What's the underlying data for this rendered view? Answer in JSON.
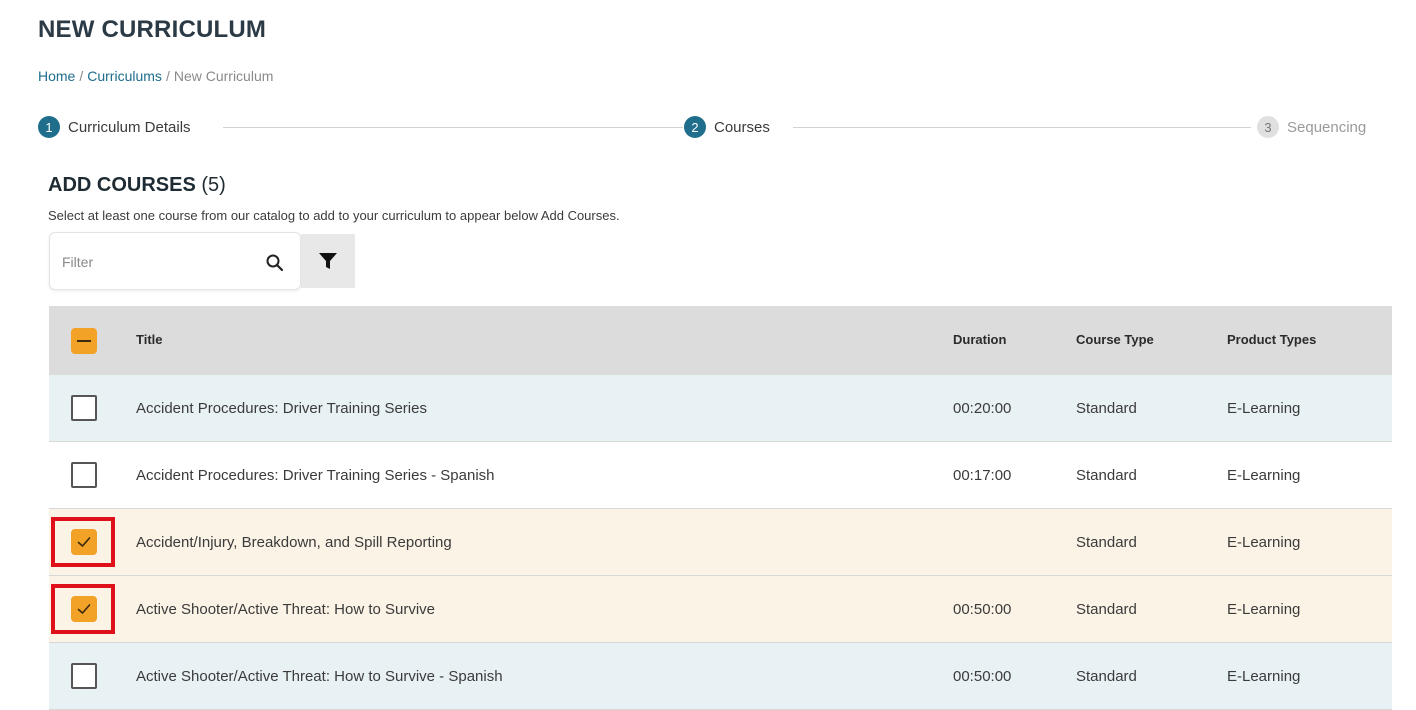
{
  "page": {
    "title": "NEW CURRICULUM"
  },
  "breadcrumb": {
    "home": "Home",
    "curriculums": "Curriculums",
    "current": "New Curriculum",
    "separator": "/"
  },
  "stepper": {
    "steps": [
      {
        "number": "1",
        "label": "Curriculum Details",
        "state": "active"
      },
      {
        "number": "2",
        "label": "Courses",
        "state": "active"
      },
      {
        "number": "3",
        "label": "Sequencing",
        "state": "inactive"
      }
    ]
  },
  "section": {
    "title": "ADD COURSES",
    "count": "(5)",
    "description": "Select at least one course from our catalog to add to your curriculum to appear below Add Courses."
  },
  "filter": {
    "placeholder": "Filter",
    "search_icon": "search-icon",
    "filter_icon": "funnel-icon"
  },
  "table": {
    "headers": {
      "title": "Title",
      "duration": "Duration",
      "course_type": "Course Type",
      "product_types": "Product Types"
    },
    "select_all_state": "partial",
    "rows": [
      {
        "title": "Accident Procedures: Driver Training Series",
        "duration": "00:20:00",
        "course_type": "Standard",
        "product_types": "E-Learning",
        "checked": false,
        "highlighted": false
      },
      {
        "title": "Accident Procedures: Driver Training Series - Spanish",
        "duration": "00:17:00",
        "course_type": "Standard",
        "product_types": "E-Learning",
        "checked": false,
        "highlighted": false
      },
      {
        "title": "Accident/Injury, Breakdown, and Spill Reporting",
        "duration": "",
        "course_type": "Standard",
        "product_types": "E-Learning",
        "checked": true,
        "highlighted": true
      },
      {
        "title": "Active Shooter/Active Threat: How to Survive",
        "duration": "00:50:00",
        "course_type": "Standard",
        "product_types": "E-Learning",
        "checked": true,
        "highlighted": true
      },
      {
        "title": "Active Shooter/Active Threat: How to Survive - Spanish",
        "duration": "00:50:00",
        "course_type": "Standard",
        "product_types": "E-Learning",
        "checked": false,
        "highlighted": false
      }
    ]
  },
  "colors": {
    "accent": "#f2a227",
    "primary": "#1f6e8c",
    "highlight": "#e0101a",
    "row_blue": "#e8f1f4",
    "row_tan": "#fbf3e6",
    "header_gray": "#dcdcdc"
  }
}
